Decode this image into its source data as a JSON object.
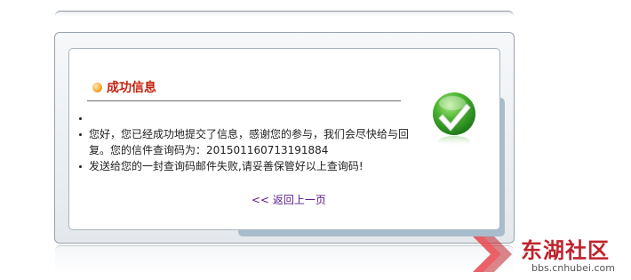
{
  "dialog": {
    "title": "成功信息",
    "messages": [
      "",
      "您好，您已经成功地提交了信息，感谢您的参与，我们会尽快给与回复。您的信件查询码为：201501160713191884",
      "发送给您的一封查询码邮件失败,请妥善保管好以上查询码!"
    ],
    "back_link": "<< 返回上一页",
    "status_icon": "success-check-icon"
  },
  "watermark": {
    "brand": "东湖社区",
    "url": "bbs.cnhubei.com"
  },
  "colors": {
    "title": "#c4220e",
    "link": "#5a1a8a",
    "check_green": "#3aa52a",
    "watermark_red": "#c0222c"
  }
}
